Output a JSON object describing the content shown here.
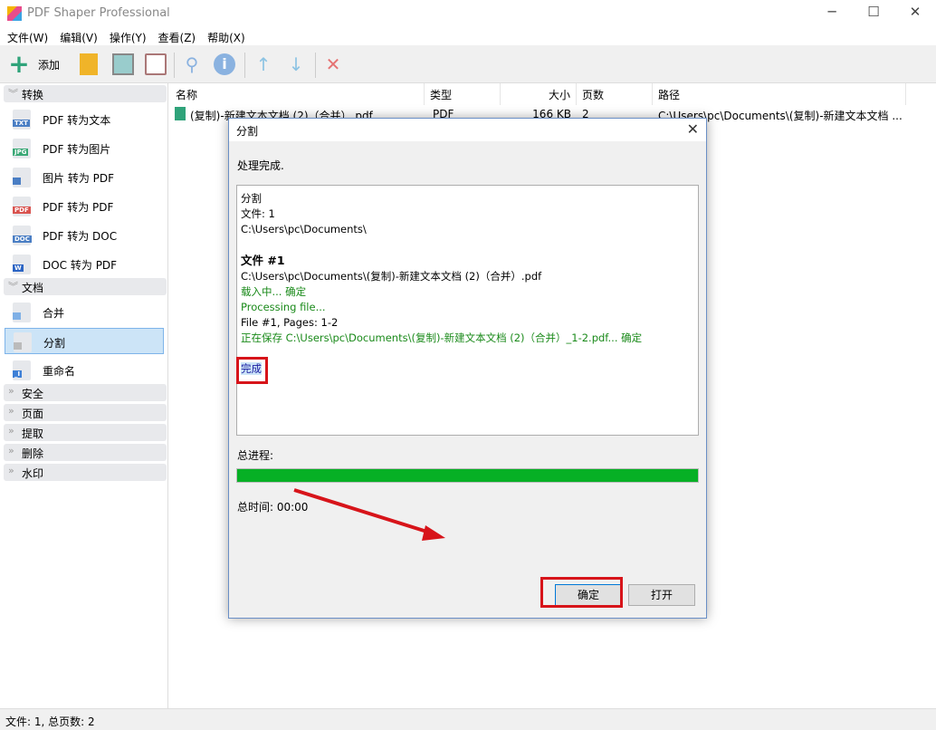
{
  "app": {
    "title": "PDF Shaper Professional",
    "minimize": "─",
    "maximize": "☐",
    "close": "✕"
  },
  "menu": [
    "文件(W)",
    "编辑(V)",
    "操作(Y)",
    "查看(Z)",
    "帮助(X)"
  ],
  "toolbar": {
    "add_label": "添加",
    "icons": [
      "plus-icon",
      "folder-icon",
      "image-icon",
      "clipboard-icon",
      "search-icon",
      "info-icon",
      "arrow-up-icon",
      "arrow-down-icon",
      "delete-icon"
    ]
  },
  "sidebar": {
    "sections": [
      {
        "label": "转换",
        "expanded": true,
        "items": [
          {
            "label": "PDF 转为文本",
            "badge": "TXT",
            "color": "#4a7ec4"
          },
          {
            "label": "PDF 转为图片",
            "badge": "JPG",
            "color": "#3aa876"
          },
          {
            "label": "图片 转为 PDF",
            "badge": "",
            "color": "#4a7ec4"
          },
          {
            "label": "PDF 转为 PDF",
            "badge": "PDF",
            "color": "#d9534f"
          },
          {
            "label": "PDF 转为 DOC",
            "badge": "DOC",
            "color": "#4a7ec4"
          },
          {
            "label": "DOC 转为 PDF",
            "badge": "W",
            "color": "#2b64c4"
          }
        ]
      },
      {
        "label": "文档",
        "expanded": true,
        "items": [
          {
            "label": "合并",
            "badge": "",
            "color": "#7fb0e6"
          },
          {
            "label": "分割",
            "badge": "",
            "color": "#bbbbbb",
            "selected": true
          },
          {
            "label": "重命名",
            "badge": "_I",
            "color": "#3d7fd6"
          }
        ]
      },
      {
        "label": "安全",
        "expanded": false
      },
      {
        "label": "页面",
        "expanded": false
      },
      {
        "label": "提取",
        "expanded": false
      },
      {
        "label": "删除",
        "expanded": false
      },
      {
        "label": "水印",
        "expanded": false
      }
    ]
  },
  "file_list": {
    "columns": [
      "名称",
      "类型",
      "大小",
      "页数",
      "路径"
    ],
    "rows": [
      {
        "name": "(复制)-新建文本文档 (2)（合并）.pdf",
        "type": "PDF",
        "size": "166 KB",
        "pages": "2",
        "path": "C:\\Users\\pc\\Documents\\(复制)-新建文本文档 ..."
      }
    ]
  },
  "status_bar": "文件: 1, 总页数: 2",
  "dialog": {
    "title": "分割",
    "close": "✕",
    "message": "处理完成.",
    "log": [
      {
        "text": "分割",
        "style": "normal"
      },
      {
        "text": "文件: 1",
        "style": "normal"
      },
      {
        "text": "C:\\Users\\pc\\Documents\\",
        "style": "normal"
      },
      {
        "text": "",
        "style": "normal"
      },
      {
        "text": "文件 #1",
        "style": "bold"
      },
      {
        "text": "C:\\Users\\pc\\Documents\\(复制)-新建文本文档 (2)（合并）.pdf",
        "style": "normal"
      },
      {
        "text": "载入中... 确定",
        "style": "green"
      },
      {
        "text": "Processing file...",
        "style": "green"
      },
      {
        "text": "File #1, Pages: 1-2",
        "style": "normal"
      },
      {
        "text": "正在保存 C:\\Users\\pc\\Documents\\(复制)-新建文本文档 (2)（合并）_1-2.pdf... 确定",
        "style": "green"
      },
      {
        "text": "",
        "style": "normal"
      },
      {
        "text": "完成",
        "style": "selected"
      }
    ],
    "progress_label": "总进程:",
    "progress_percent": 100,
    "time_label": "总时间: 00:00",
    "ok_label": "确定",
    "open_label": "打开"
  },
  "colors": {
    "progress": "#06b025",
    "annotation": "#d7141a",
    "selection": "#cce4f7",
    "log_green": "#1a8a1a"
  }
}
